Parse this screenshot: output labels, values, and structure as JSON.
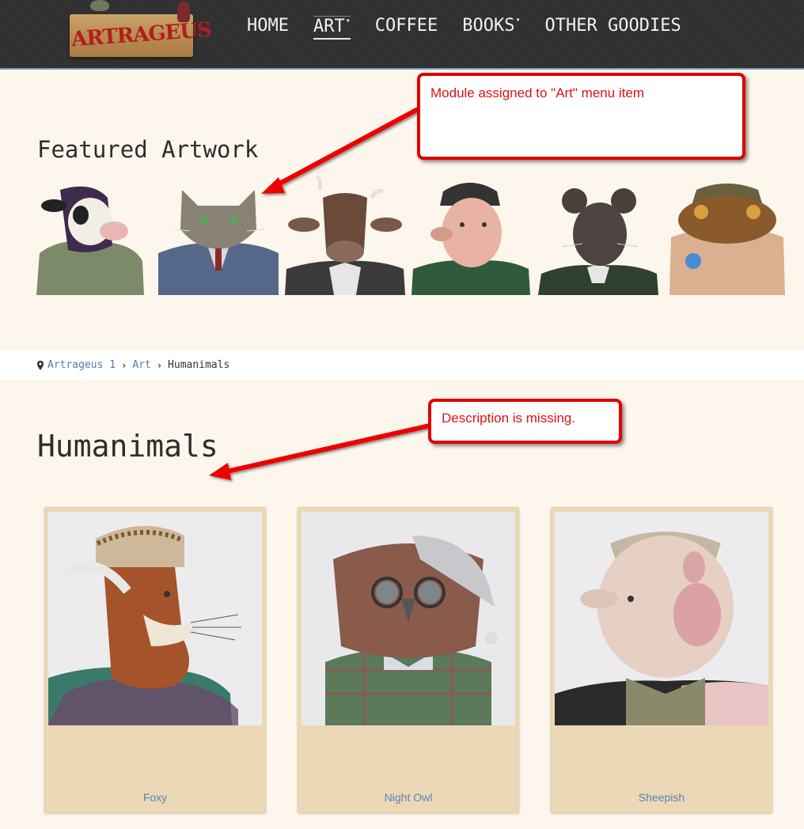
{
  "logo": {
    "text": "ARTRAGEUS"
  },
  "nav": {
    "items": [
      {
        "label": "HOME",
        "active": false,
        "caret": false
      },
      {
        "label": "ART",
        "active": true,
        "caret": true
      },
      {
        "label": "COFFEE",
        "active": false,
        "caret": false
      },
      {
        "label": "BOOKS",
        "active": false,
        "caret": true
      },
      {
        "label": "OTHER GOODIES",
        "active": false,
        "caret": false
      }
    ]
  },
  "featured": {
    "title": "Featured Artwork",
    "items": [
      {
        "name": "cow-sculpture",
        "color": "#3e2b4d"
      },
      {
        "name": "cat-sculpture",
        "color": "#55688a"
      },
      {
        "name": "bull-sculpture",
        "color": "#6b4a3a"
      },
      {
        "name": "pig-sculpture",
        "color": "#2f5a3c"
      },
      {
        "name": "rat-sculpture",
        "color": "#2f4030"
      },
      {
        "name": "frog-sculpture",
        "color": "#8a5a2a"
      }
    ]
  },
  "breadcrumb": {
    "items": [
      {
        "label": "Artrageus 1",
        "link": true
      },
      {
        "label": "Art",
        "link": true
      },
      {
        "label": "Humanimals",
        "link": false
      }
    ]
  },
  "category": {
    "title": "Humanimals"
  },
  "cards": [
    {
      "label": "Foxy"
    },
    {
      "label": "Night Owl"
    },
    {
      "label": "Sheepish"
    }
  ],
  "annotations": {
    "module_note": "Module assigned to \"Art\" menu item",
    "description_note": "Description is missing."
  },
  "colors": {
    "page_bg": "#fdf6ec",
    "nav_bg": "#2e2e2e",
    "card_bg": "#ecd8b6",
    "link": "#5a85b5",
    "annotation_red": "#e00000"
  }
}
